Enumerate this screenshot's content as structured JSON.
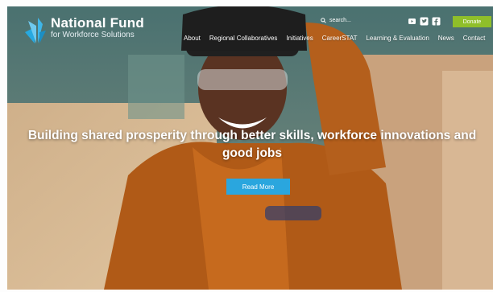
{
  "brand": {
    "name": "National Fund",
    "tagline": "for Workforce Solutions"
  },
  "header": {
    "search_placeholder": "search...",
    "social_icons": [
      "youtube-icon",
      "twitter-icon",
      "facebook-icon"
    ],
    "donate_label": "Donate"
  },
  "nav": {
    "items": [
      {
        "label": "About"
      },
      {
        "label": "Regional Collaboratives"
      },
      {
        "label": "Initiatives"
      },
      {
        "label": "CareerSTAT"
      },
      {
        "label": "Learning & Evaluation"
      },
      {
        "label": "News"
      },
      {
        "label": "Contact"
      }
    ]
  },
  "hero": {
    "headline_line1": "Building shared prosperity through better skills, workforce innovations and",
    "headline_line2": "good jobs",
    "cta_label": "Read More"
  },
  "colors": {
    "accent": "#2aa6de",
    "donate": "#8fbf2a",
    "logo_blue": "#27a9e0"
  }
}
